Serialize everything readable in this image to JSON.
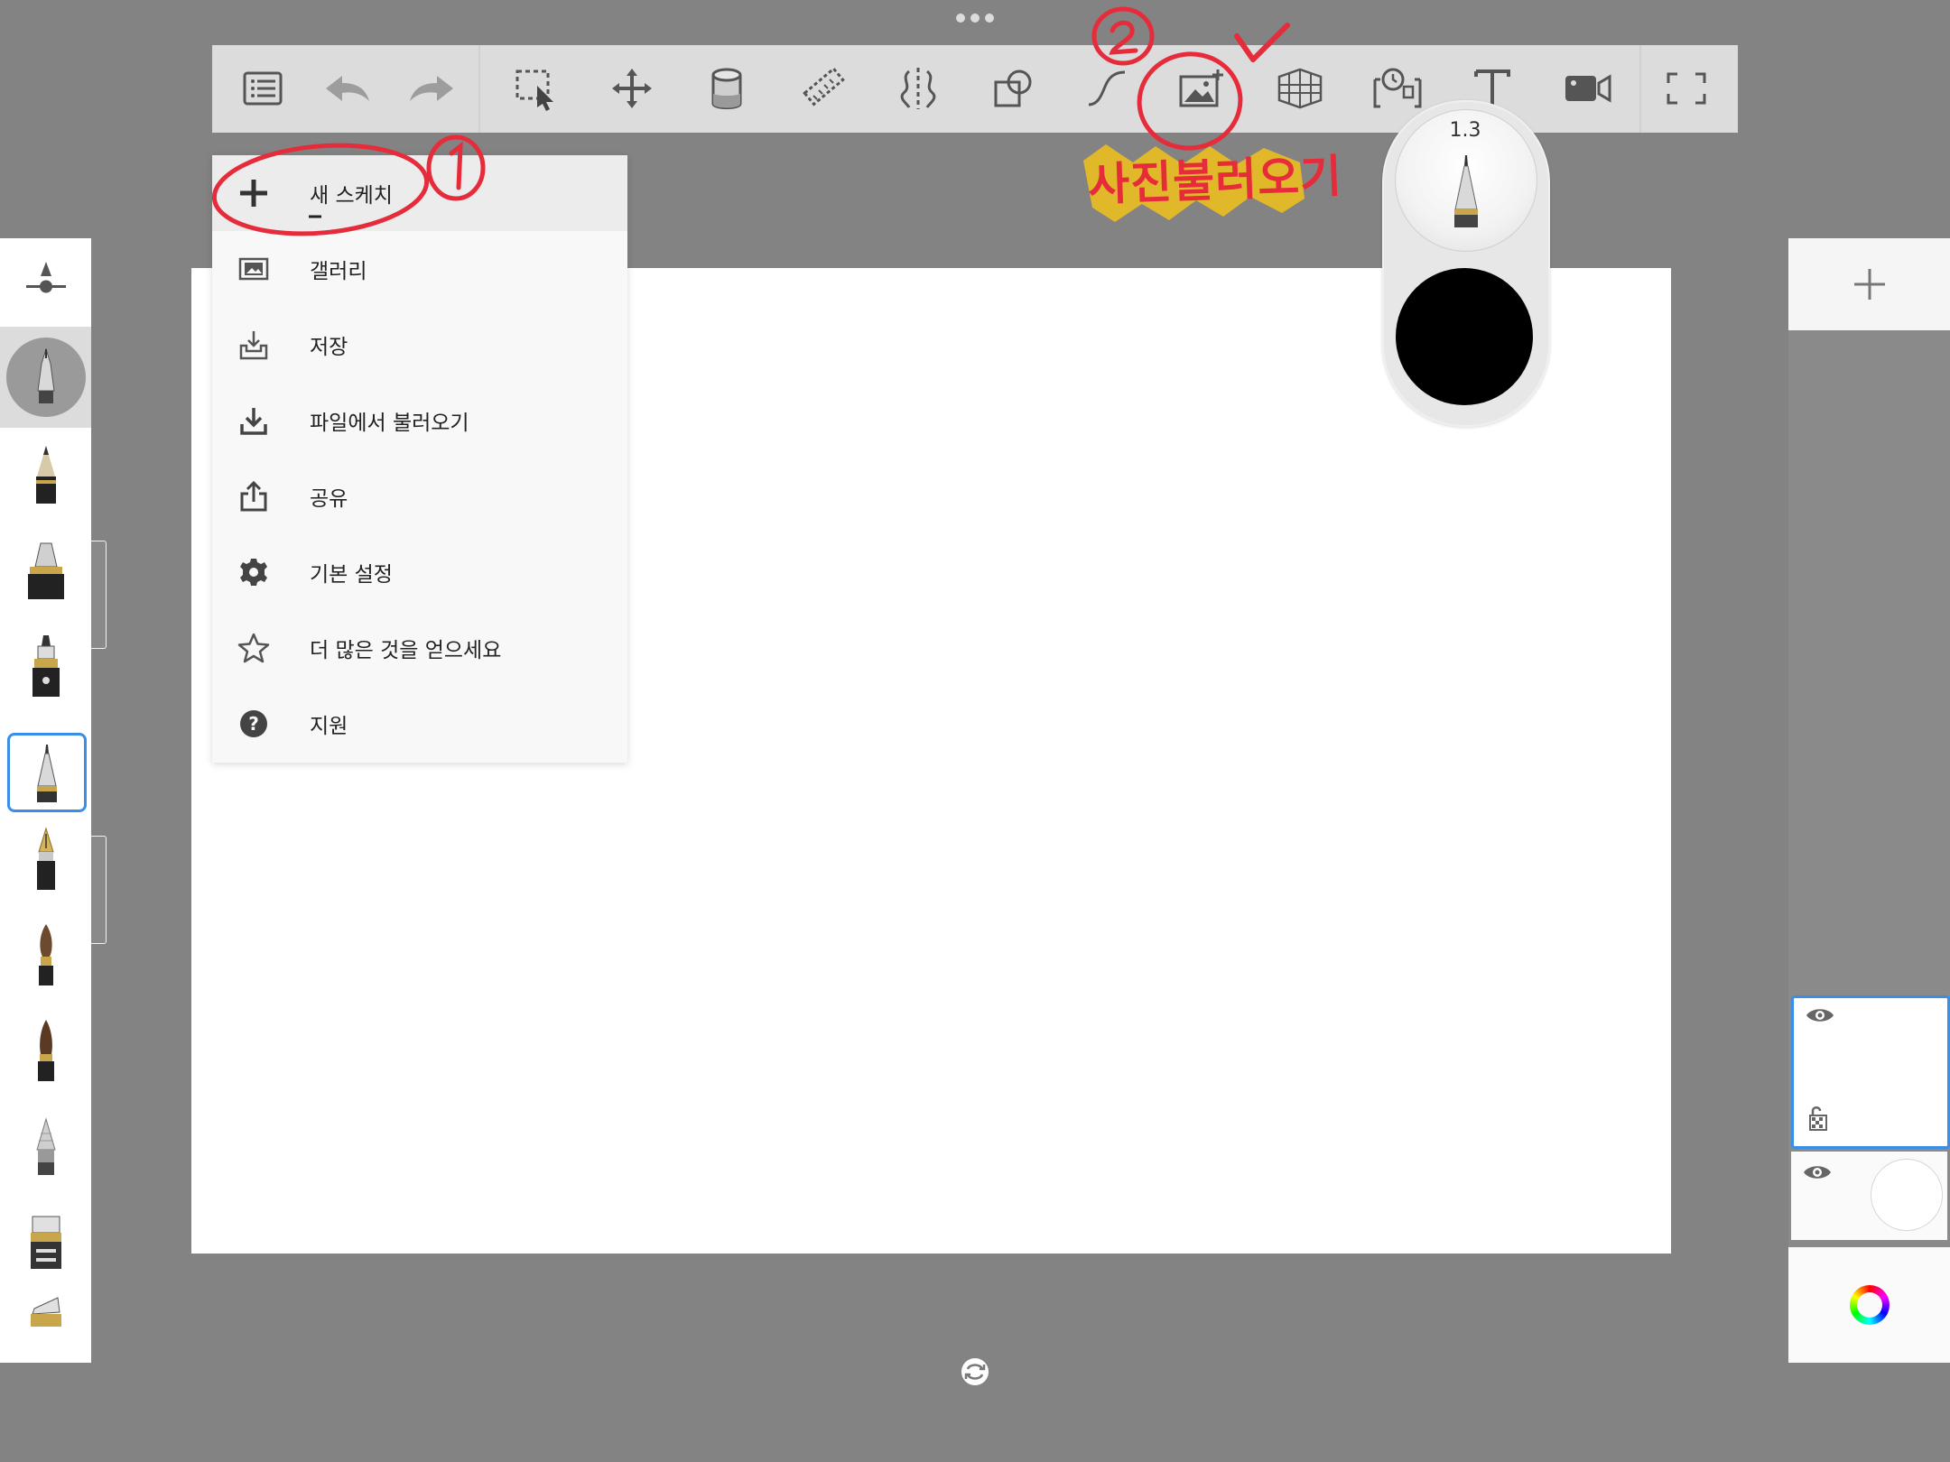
{
  "toolbar": {
    "tools": [
      {
        "name": "list-icon"
      },
      {
        "name": "undo-icon"
      },
      {
        "name": "redo-icon"
      },
      {
        "name": "selection-icon"
      },
      {
        "name": "transform-icon"
      },
      {
        "name": "fill-bucket-icon"
      },
      {
        "name": "ruler-icon"
      },
      {
        "name": "symmetry-icon"
      },
      {
        "name": "shapes-icon"
      },
      {
        "name": "stroke-icon"
      },
      {
        "name": "import-image-icon"
      },
      {
        "name": "perspective-icon"
      },
      {
        "name": "time-lapse-icon"
      },
      {
        "name": "text-icon"
      },
      {
        "name": "record-icon"
      },
      {
        "name": "fullscreen-icon"
      }
    ]
  },
  "menu": {
    "items": [
      {
        "icon": "plus-icon",
        "label": "새 스케치"
      },
      {
        "icon": "gallery-icon",
        "label": "갤러리"
      },
      {
        "icon": "save-icon",
        "label": "저장"
      },
      {
        "icon": "download-icon",
        "label": "파일에서 불러오기"
      },
      {
        "icon": "share-icon",
        "label": "공유"
      },
      {
        "icon": "gear-icon",
        "label": "기본 설정"
      },
      {
        "icon": "star-icon",
        "label": "더 많은 것을 얻으세요"
      },
      {
        "icon": "help-icon",
        "label": "지원"
      }
    ]
  },
  "brush_popup": {
    "size": "1.3",
    "color": "#000000"
  },
  "annotations": {
    "label": "사진불러오기",
    "numbers": [
      "1",
      "2"
    ],
    "color": "#e62b3a",
    "highlight": "#f3c21c"
  },
  "layers": {
    "selected_border": "#3b8ee6"
  }
}
